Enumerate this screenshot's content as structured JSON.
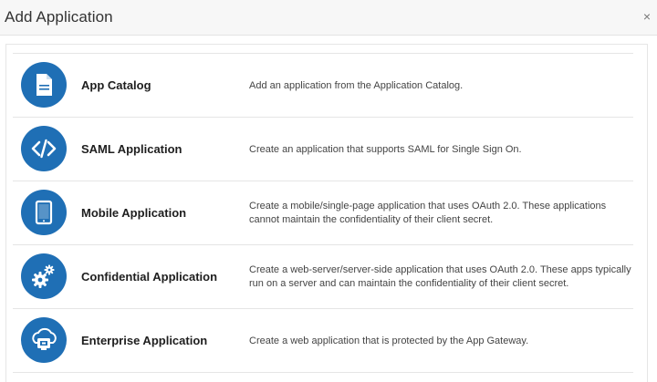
{
  "dialog": {
    "title": "Add Application",
    "close_label": "×"
  },
  "items": [
    {
      "title": "App Catalog",
      "description": "Add an application from the Application Catalog.",
      "icon": "document-icon"
    },
    {
      "title": "SAML Application",
      "description": "Create an application that supports SAML for Single Sign On.",
      "icon": "code-icon"
    },
    {
      "title": "Mobile Application",
      "description": "Create a mobile/single-page application that uses OAuth 2.0. These applications cannot maintain the confidentiality of their client secret.",
      "icon": "tablet-icon"
    },
    {
      "title": "Confidential Application",
      "description": "Create a web-server/server-side application that uses OAuth 2.0. These apps typically run on a server and can maintain the confidentiality of their client secret.",
      "icon": "gears-icon"
    },
    {
      "title": "Enterprise Application",
      "description": "Create a web application that is protected by the App Gateway.",
      "icon": "cloud-gateway-icon"
    }
  ],
  "colors": {
    "icon_background": "#1f6fb5",
    "header_background": "#f7f7f7"
  }
}
